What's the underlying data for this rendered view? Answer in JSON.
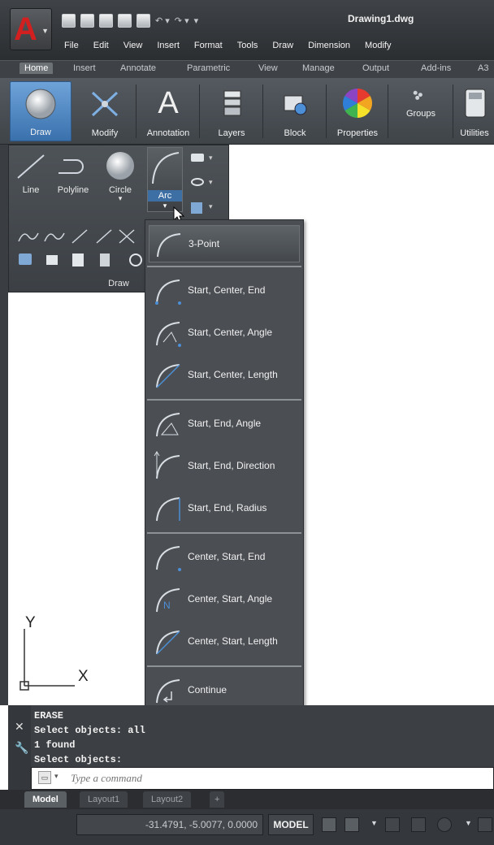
{
  "title_bar": {
    "document_title": "Drawing1.dwg",
    "app_button_glyph": "A",
    "menu": [
      "File",
      "Edit",
      "View",
      "Insert",
      "Format",
      "Tools",
      "Draw",
      "Dimension",
      "Modify"
    ]
  },
  "ribbon_tabs": [
    "Home",
    "Insert",
    "Annotate",
    "Parametric",
    "View",
    "Manage",
    "Output",
    "Add-ins",
    "A3"
  ],
  "ribbon_panels": [
    {
      "label": "Draw",
      "icon": "circle-icon"
    },
    {
      "label": "Modify",
      "icon": "modify-icon"
    },
    {
      "label": "Annotation",
      "icon": "text-a-icon",
      "glyph": "A"
    },
    {
      "label": "Layers",
      "icon": "layers-icon"
    },
    {
      "label": "Block",
      "icon": "block-icon"
    },
    {
      "label": "Properties",
      "icon": "color-wheel-icon"
    },
    {
      "label": "Groups",
      "icon": "groups-icon"
    },
    {
      "label": "Utilities",
      "icon": "utilities-icon"
    }
  ],
  "draw_panel": {
    "title": "Draw",
    "tools": [
      "Line",
      "Polyline",
      "Circle",
      "Arc"
    ]
  },
  "arc_menu": {
    "items": [
      {
        "label": "3-Point",
        "group": 1,
        "highlighted": true
      },
      {
        "label": "Start, Center, End",
        "group": 2
      },
      {
        "label": "Start, Center, Angle",
        "group": 2
      },
      {
        "label": "Start, Center, Length",
        "group": 2
      },
      {
        "label": "Start, End, Angle",
        "group": 3
      },
      {
        "label": "Start, End, Direction",
        "group": 3
      },
      {
        "label": "Start, End, Radius",
        "group": 3
      },
      {
        "label": "Center, Start, End",
        "group": 4
      },
      {
        "label": "Center, Start, Angle",
        "group": 4
      },
      {
        "label": "Center, Start, Length",
        "group": 4
      },
      {
        "label": "Continue",
        "group": 5
      }
    ]
  },
  "ucs": {
    "x_label": "X",
    "y_label": "Y"
  },
  "command_line": {
    "history": [
      "ERASE",
      "Select objects: all",
      "1 found",
      "Select objects:"
    ],
    "placeholder": "Type a command"
  },
  "layout_tabs": [
    "Model",
    "Layout1",
    "Layout2",
    "+"
  ],
  "status_bar": {
    "coordinates": "-31.4791, -5.0077, 0.0000",
    "model_label": "MODEL"
  },
  "colors": {
    "accent_blue": "#3a71ad",
    "logo_red": "#d21f1f",
    "arc_icon_blue": "#4d8fd6"
  }
}
